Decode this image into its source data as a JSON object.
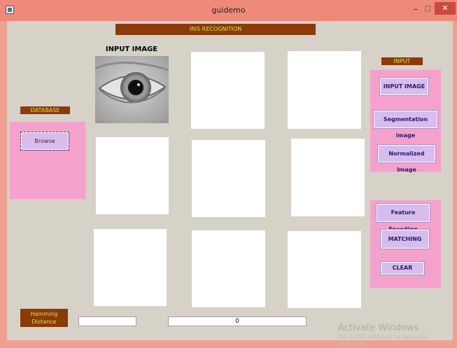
{
  "window": {
    "title": "guidemo",
    "minimize": "–",
    "maximize": "□",
    "close": "✕"
  },
  "banners": {
    "title": "IRIS RECOGNITION",
    "input": "INPUT",
    "database": "DATABASE",
    "hamming": "Hamming\nDistance"
  },
  "headings": {
    "input_image": "INPUT IMAGE"
  },
  "buttons": {
    "browse": "Browse",
    "input_image": "INPUT IMAGE",
    "segmentation": "Segmentation image",
    "normalized": "Normalized Image",
    "feature_encoding": "Feature Encoding",
    "matching": "MATCHING",
    "clear": "CLEAR"
  },
  "fields": {
    "hamming_value": "",
    "result_value": "0"
  },
  "watermark": {
    "title": "Activate Windows",
    "subtitle": "Go to PC settings to activate Windows."
  },
  "colors": {
    "titlebar": "#ee8a7a",
    "banner": "#8b3a0a",
    "banner_text": "#d8e83a",
    "panel": "#f4a2cc",
    "button": "#d6bdee",
    "client": "#d6d2c8"
  }
}
